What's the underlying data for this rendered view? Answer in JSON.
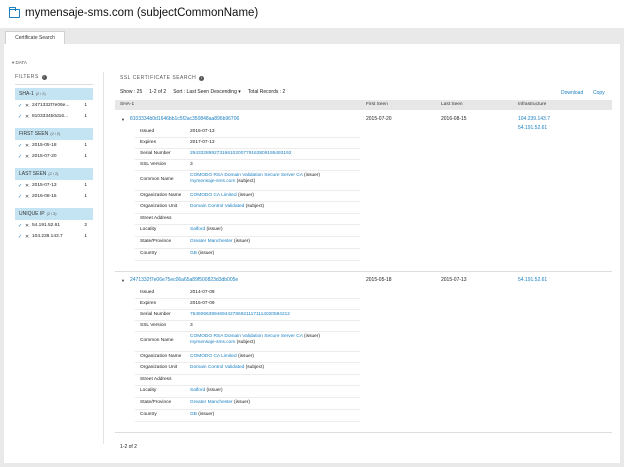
{
  "header": {
    "title": "mymensaje-sms.com (subjectCommonName)"
  },
  "tabs": [
    {
      "label": "Certificate Search"
    }
  ],
  "data_toggle": "▾ DATA",
  "filters": {
    "title": "FILTERS",
    "groups": [
      {
        "title": "SHA-1",
        "count": "(2 / 2)",
        "rows": [
          {
            "value": "2471332f7e06e...",
            "count": "1"
          },
          {
            "value": "8103334b0d16...",
            "count": "1"
          }
        ]
      },
      {
        "title": "FIRST SEEN",
        "count": "(2 / 2)",
        "rows": [
          {
            "value": "2015-05-18",
            "count": "1"
          },
          {
            "value": "2015-07-20",
            "count": "1"
          }
        ]
      },
      {
        "title": "LAST SEEN",
        "count": "(2 / 2)",
        "rows": [
          {
            "value": "2015-07-13",
            "count": "1"
          },
          {
            "value": "2016-08-15",
            "count": "1"
          }
        ]
      },
      {
        "title": "UNIQUE IP",
        "count": "(2 / 3)",
        "rows": [
          {
            "value": "54.191.52.61",
            "count": "2"
          },
          {
            "value": "104.239.143.7",
            "count": "1"
          }
        ]
      }
    ]
  },
  "main": {
    "title": "SSL CERTIFICATE SEARCH",
    "download": "Download",
    "copy": "Copy",
    "show": "Show : 25",
    "range": "1-2 of 2",
    "sort": "Sort : Last Seen Descending ▾",
    "total": "Total Records : 2",
    "columns": {
      "sha1": "SHA-1",
      "first": "First Seen",
      "last": "Last Seen",
      "infra": "Infrastructure"
    },
    "pager": "1-2 of 2"
  },
  "records": [
    {
      "hash": "8103334b0d1646bb1c5f2ac350848aa896b96706",
      "first": "2015-07-20",
      "last": "2016-08-15",
      "ips": [
        "104.239.143.7",
        "54.191.52.61"
      ],
      "details": {
        "issued": "2015-07-13",
        "expires": "2017-07-13",
        "serial": "29433289927316610200779163809195493192",
        "ssl": "3",
        "cn_issuer": "COMODO RSA Domain Validation Secure Server CA",
        "cn_subject": "mymensaje-sms.com",
        "org": "COMODO CA Limited",
        "ou": "Domain Control Validated",
        "locality": "Salford",
        "state": "Greater Manchester",
        "country": "GB"
      }
    },
    {
      "hash": "2471332f7e06e75ec06a65a89f500823d3db005e",
      "first": "2015-05-18",
      "last": "2015-07-13",
      "ips": [
        "54.191.52.61"
      ],
      "details": {
        "issued": "2014-07-08",
        "expires": "2015-07-09",
        "serial": "76450663994694427869211171114020584212",
        "ssl": "3",
        "cn_issuer": "COMODO RSA Domain Validation Secure Server CA",
        "cn_subject": "mymensaje-sms.com",
        "org": "COMODO CA Limited",
        "ou": "Domain Control Validated",
        "locality": "Salford",
        "state": "Greater Manchester",
        "country": "GB"
      }
    }
  ],
  "labels": {
    "issued": "Issued",
    "expires": "Expires",
    "serial": "Serial Number",
    "ssl": "SSL Version",
    "cn": "Common Name",
    "org": "Organization Name",
    "ou": "Organization Unit",
    "street": "Street Address",
    "locality": "Locality",
    "state": "State/Province",
    "country": "Country",
    "issuer": "(issuer)",
    "subject": "(subject)"
  }
}
